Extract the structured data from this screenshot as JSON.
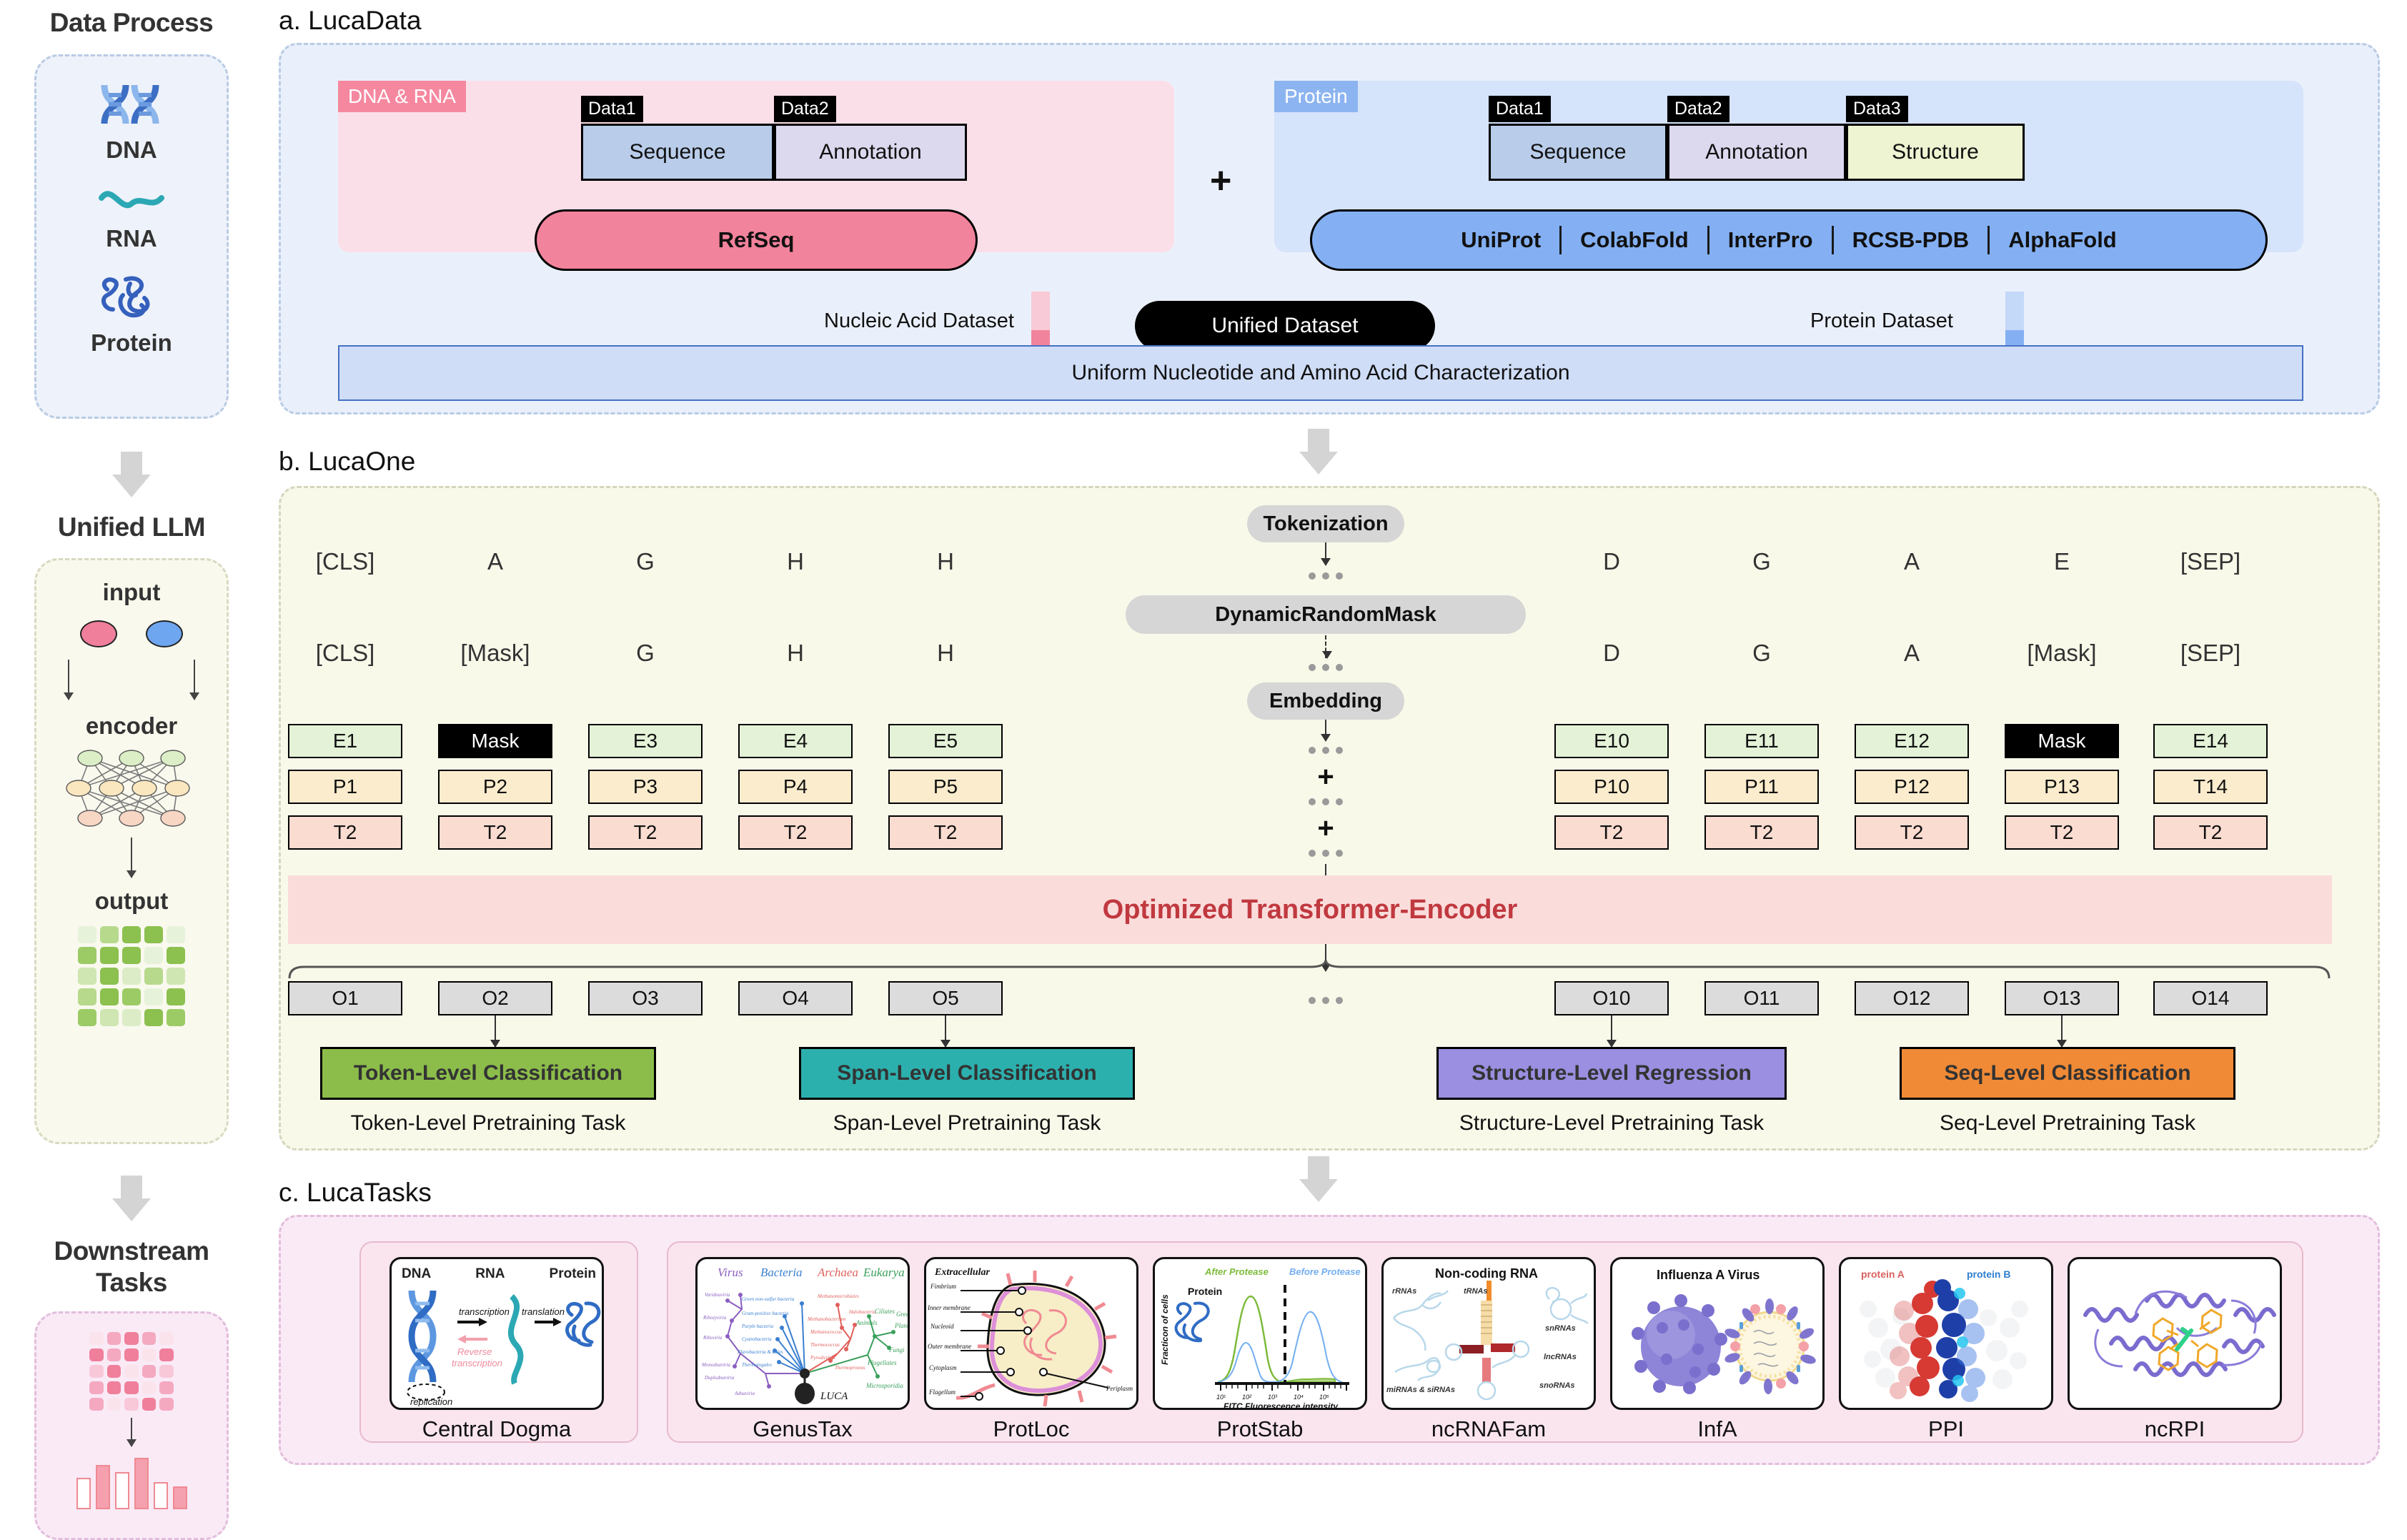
{
  "rail": {
    "sections": [
      {
        "title": "Data Process",
        "items": [
          {
            "icon": "dna-helix-icon",
            "label": "DNA"
          },
          {
            "icon": "rna-wave-icon",
            "label": "RNA"
          },
          {
            "icon": "protein-fold-icon",
            "label": "Protein"
          }
        ]
      },
      {
        "title": "Unified LLM",
        "items": [
          {
            "label": "input"
          },
          {
            "label": "encoder"
          },
          {
            "label": "output"
          }
        ]
      },
      {
        "title": "Downstream Tasks",
        "items": []
      }
    ]
  },
  "panel_a": {
    "label": "a. LucaData",
    "nucleic": {
      "tag": "DNA & RNA",
      "tag_color": "#f5889f",
      "block_color": "#fbdfe8",
      "data_tabs": [
        "Data1",
        "Data2"
      ],
      "data_cells": [
        "Sequence",
        "Annotation"
      ],
      "source_pill": "RefSeq",
      "source_pill_color": "#f2839c"
    },
    "plus": "+",
    "protein": {
      "tag": "Protein",
      "tag_color": "#8cb4f0",
      "block_color": "#d5e3fb",
      "data_tabs": [
        "Data1",
        "Data2",
        "Data3"
      ],
      "data_cells": [
        "Sequence",
        "Annotation",
        "Structure"
      ],
      "sources": [
        "UniProt",
        "ColabFold",
        "InterPro",
        "RCSB-PDB",
        "AlphaFold"
      ],
      "source_pill_color": "#84b0f3"
    },
    "left_arrow_label": "Nucleic Acid Dataset",
    "center_capsule": "Unified Dataset",
    "right_arrow_label": "Protein Dataset",
    "unified_bar": "Uniform Nucleotide and Amino Acid  Characterization"
  },
  "panel_b": {
    "label": "b. LucaOne",
    "pipeline": [
      "Tokenization",
      "DynamicRandomMask",
      "Embedding"
    ],
    "plus_signs": [
      "+",
      "+"
    ],
    "row_tokens_pre": [
      "[CLS]",
      "A",
      "G",
      "H",
      "H",
      "D",
      "G",
      "A",
      "E",
      "[SEP]"
    ],
    "row_tokens_post": [
      "[CLS]",
      "[Mask]",
      "G",
      "H",
      "H",
      "D",
      "G",
      "A",
      "[Mask]",
      "[SEP]"
    ],
    "row_e": [
      "E1",
      "Mask",
      "E3",
      "E4",
      "E5",
      "E10",
      "E11",
      "E12",
      "Mask",
      "E14"
    ],
    "row_p": [
      "P1",
      "P2",
      "P3",
      "P4",
      "P5",
      "P10",
      "P11",
      "P12",
      "P13",
      "T14"
    ],
    "row_t": [
      "T2",
      "T2",
      "T2",
      "T2",
      "T2",
      "T2",
      "T2",
      "T2",
      "T2",
      "T2"
    ],
    "row_o": [
      "O1",
      "O2",
      "O3",
      "O4",
      "O5",
      "O10",
      "O11",
      "O12",
      "O13",
      "O14"
    ],
    "encoder_bar": "Optimized Transformer-Encoder",
    "encoder_bar_color": "#fadcdb",
    "encoder_text_color": "#c0393f",
    "tasks": [
      {
        "title": "Token-Level Classification",
        "caption": "Token-Level Pretraining Task",
        "color": "#8cbd4b"
      },
      {
        "title": "Span-Level Classification",
        "caption": "Span-Level Pretraining Task",
        "color": "#2cb0ae"
      },
      {
        "title": "Structure-Level Regression",
        "caption": "Structure-Level Pretraining Task",
        "color": "#9a8fe0"
      },
      {
        "title": "Seq-Level Classification",
        "caption": "Seq-Level Pretraining Task",
        "color": "#f08a36"
      }
    ]
  },
  "panel_c": {
    "label": "c. LucaTasks",
    "cards": [
      {
        "caption": "Central Dogma",
        "thumb": {
          "headers": [
            "DNA",
            "RNA",
            "Protein"
          ],
          "annotations": [
            "transcription",
            "translation",
            "Reverse transcription",
            "replication"
          ]
        }
      },
      {
        "caption": "GenusTax",
        "thumb": {
          "domains": [
            "Virus",
            "Bacteria",
            "Archaea",
            "Eukarya"
          ],
          "root": "LUCA",
          "virus_taxa": [
            "Varidnaviria",
            "Riboviria",
            "Ribozyviria",
            "Monodnaviria",
            "Duplodnaviria",
            "Adnaviria"
          ],
          "bacteria_taxa": [
            "Green non-sulfur bacteria",
            "Gram-positive bacteria",
            "Purple bacteria",
            "Cyanobacteria",
            "Flavobacteria & allies",
            "Thermotogales"
          ],
          "archaea_taxa": [
            "Methanomicrobiales",
            "Halobacteria",
            "Methanobacterium",
            "Methanococcus",
            "Thermococcus",
            "Pyrodictium",
            "Thermoproteus"
          ],
          "eukarya_taxa": [
            "Ciliates",
            "Green Plants",
            "Animals",
            "Fungi",
            "Flagellates",
            "Microsporidia"
          ]
        }
      },
      {
        "caption": "ProtLoc",
        "thumb": {
          "title": "Extracellular",
          "parts": [
            "Fimbrium",
            "Inner membrane",
            "Nucleoid",
            "Outer membrane",
            "Cytoplasm",
            "Flagellum",
            "Periplasm"
          ]
        }
      },
      {
        "caption": "ProtStab",
        "thumb": {
          "legend": [
            "After Protease",
            "Before Protease"
          ],
          "inline_label": "Protein",
          "ylabel": "Fracticon of cells",
          "xlabel": "FITC Fluorescence intensity",
          "xticks": [
            "10¹",
            "10²",
            "10³",
            "10⁴",
            "10⁵"
          ]
        }
      },
      {
        "caption": "ncRNAFam",
        "thumb": {
          "title": "Non-coding RNA",
          "classes": [
            "rRNAs",
            "tRNAs",
            "snRNAs",
            "lncRNAs",
            "snoRNAs",
            "miRNAs & siRNAs"
          ]
        }
      },
      {
        "caption": "InfA",
        "thumb": {
          "title": "Influenza A Virus"
        }
      },
      {
        "caption": "PPI",
        "thumb": {
          "labels": [
            "protein A",
            "protein B"
          ]
        }
      },
      {
        "caption": "ncRPI",
        "thumb": {}
      }
    ]
  }
}
